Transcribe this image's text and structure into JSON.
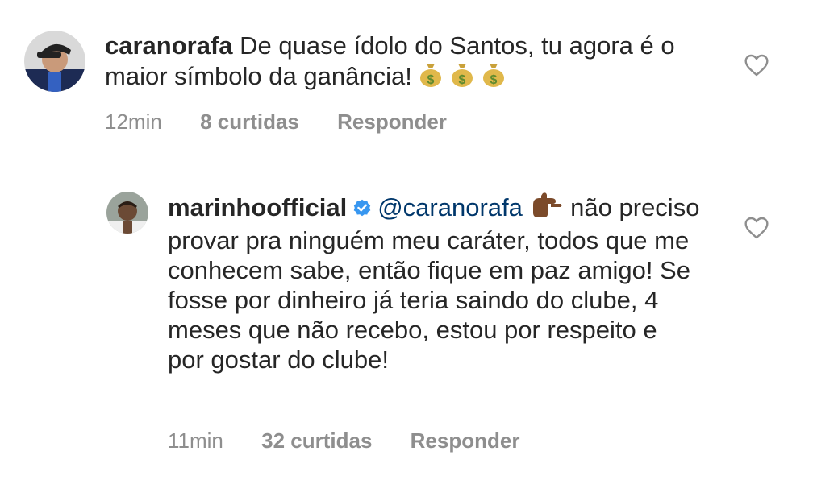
{
  "comment1": {
    "username": "caranorafa",
    "text": "De quase ídolo do Santos, tu agora é o maior símbolo da ganância!",
    "emojis": [
      "money-bag",
      "money-bag",
      "money-bag"
    ],
    "time": "12min",
    "likes": "8 curtidas",
    "reply": "Responder"
  },
  "comment2": {
    "username": "marinhoofficial",
    "verified": true,
    "mention": "@caranorafa",
    "emoji": "thumb-pointing-hand",
    "text_line1": "não",
    "text_rest": "preciso provar pra ninguém meu caráter, todos que me conhecem sabe, então fique em paz amigo!  Se fosse por dinheiro já teria saindo do clube, 4 meses que não recebo, estou por respeito e por gostar do clube!",
    "time": "11min",
    "likes": "32 curtidas",
    "reply": "Responder"
  },
  "colors": {
    "text": "#262626",
    "secondary": "#8e8e8e",
    "mention": "#00376b",
    "verified": "#3897f0"
  }
}
